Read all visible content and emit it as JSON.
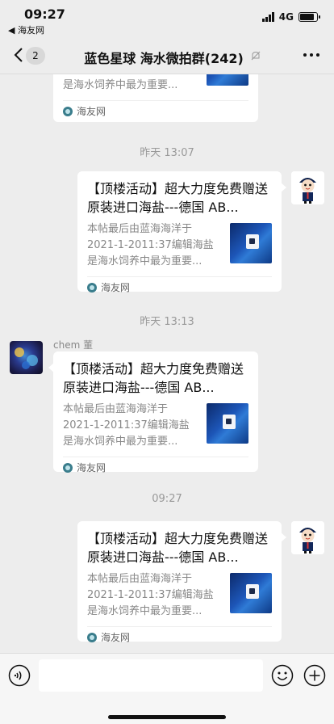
{
  "status_bar": {
    "time": "09:27",
    "back_app": "◀ 海友网",
    "network": "4G"
  },
  "nav": {
    "back_count": "2",
    "title": "蓝色星球 海水微拍群(242)"
  },
  "messages": [
    {
      "sender": "me",
      "partial": true,
      "desc": "是海水饲养中最为重要...",
      "source": "海友网"
    },
    {
      "time": "昨天 13:07",
      "sender": "me",
      "title": "【顶楼活动】超大力度免费赠送原装进口海盐---德国 AB...",
      "desc": "本帖最后由蓝海海洋于2021-1-2011:37编辑海盐是海水饲养中最为重要...",
      "source": "海友网"
    },
    {
      "time": "昨天 13:13",
      "sender": "chem 董",
      "title": "【顶楼活动】超大力度免费赠送原装进口海盐---德国 AB...",
      "desc": "本帖最后由蓝海海洋于2021-1-2011:37编辑海盐是海水饲养中最为重要...",
      "source": "海友网"
    },
    {
      "time": "09:27",
      "sender": "me",
      "title": "【顶楼活动】超大力度免费赠送原装进口海盐---德国 AB...",
      "desc": "本帖最后由蓝海海洋于2021-1-2011:37编辑海盐是海水饲养中最为重要...",
      "source": "海友网"
    }
  ]
}
